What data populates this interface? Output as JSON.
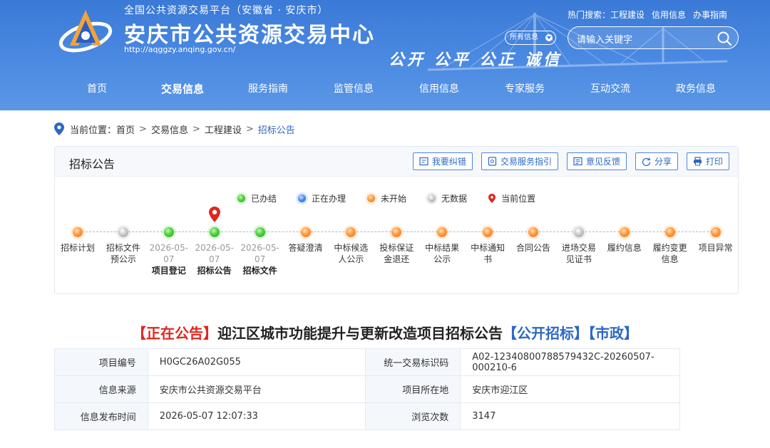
{
  "header": {
    "top_title": "全国公共资源交易平台（安徽省 · 安庆市）",
    "main_title": "安庆市公共资源交易中心",
    "url": "http://aqggzy.anqing.gov.cn/",
    "slogan": "公开 公平 公正 诚信",
    "hot_label": "热门搜索：",
    "hot_links": [
      "工程建设",
      "信用信息",
      "办事指南"
    ],
    "search_scope": "所有信息",
    "search_placeholder": "请输入关键字",
    "nav": [
      "首页",
      "交易信息",
      "服务指南",
      "监管信息",
      "信用信息",
      "专家服务",
      "互动交流",
      "政务信息"
    ],
    "nav_active": "交易信息",
    "brand_color": "#3a79d6"
  },
  "breadcrumb": {
    "label": "当前位置：",
    "items": [
      "首页",
      "交易信息",
      "工程建设",
      "招标公告"
    ],
    "separator": ">"
  },
  "process": {
    "title": "招标公告",
    "tools": [
      {
        "label": "我要纠错",
        "icon": "edit-icon"
      },
      {
        "label": "交易服务指引",
        "icon": "guide-icon"
      },
      {
        "label": "意见反馈",
        "icon": "feedback-icon"
      },
      {
        "label": "分享",
        "icon": "share-icon"
      },
      {
        "label": "打印",
        "icon": "print-icon"
      }
    ],
    "legend": [
      {
        "label": "已办结",
        "status": "done"
      },
      {
        "label": "正在办理",
        "status": "doing"
      },
      {
        "label": "未开始",
        "status": "todo"
      },
      {
        "label": "无数据",
        "status": "nodata"
      },
      {
        "label": "当前位置",
        "status": "current"
      }
    ],
    "steps": [
      {
        "lines": [
          "招标计划"
        ],
        "status": "todo"
      },
      {
        "lines": [
          "招标文件",
          "预公示"
        ],
        "status": "nodata"
      },
      {
        "date": [
          "2026-05-",
          "07"
        ],
        "name": "项目登记",
        "status": "done"
      },
      {
        "date": [
          "2026-05-",
          "07"
        ],
        "name": "招标公告",
        "status": "done",
        "current": true
      },
      {
        "date": [
          "2026-05-",
          "07"
        ],
        "name": "招标文件",
        "status": "done"
      },
      {
        "lines": [
          "答疑澄清"
        ],
        "status": "todo"
      },
      {
        "lines": [
          "中标候选",
          "人公示"
        ],
        "status": "todo"
      },
      {
        "lines": [
          "投标保证",
          "金退还"
        ],
        "status": "todo"
      },
      {
        "lines": [
          "中标结果",
          "公示"
        ],
        "status": "todo"
      },
      {
        "lines": [
          "中标通知",
          "书"
        ],
        "status": "todo"
      },
      {
        "lines": [
          "合同公告"
        ],
        "status": "todo"
      },
      {
        "lines": [
          "进场交易",
          "见证书"
        ],
        "status": "nodata"
      },
      {
        "lines": [
          "履约信息"
        ],
        "status": "todo"
      },
      {
        "lines": [
          "履约变更",
          "信息"
        ],
        "status": "todo"
      },
      {
        "lines": [
          "项目异常"
        ],
        "status": "todo"
      }
    ]
  },
  "notice": {
    "status": "【正在公告】",
    "title": "迎江区城市功能提升与更新改造项目招标公告",
    "tags": [
      "【公开招标】",
      "【市政】"
    ]
  },
  "info_rows": [
    {
      "k1": "项目编号",
      "v1": "H0GC26A02G055",
      "k2": "统一交易标识码",
      "v2": "A02-12340800788579432C-20260507-000210-6"
    },
    {
      "k1": "信息来源",
      "v1": "安庆市公共资源交易平台",
      "k2": "项目所在地",
      "v2": "安庆市迎江区"
    },
    {
      "k1": "信息发布时间",
      "v1": "2026-05-07 12:07:33",
      "k2": "浏览次数",
      "v2": "3147"
    }
  ]
}
